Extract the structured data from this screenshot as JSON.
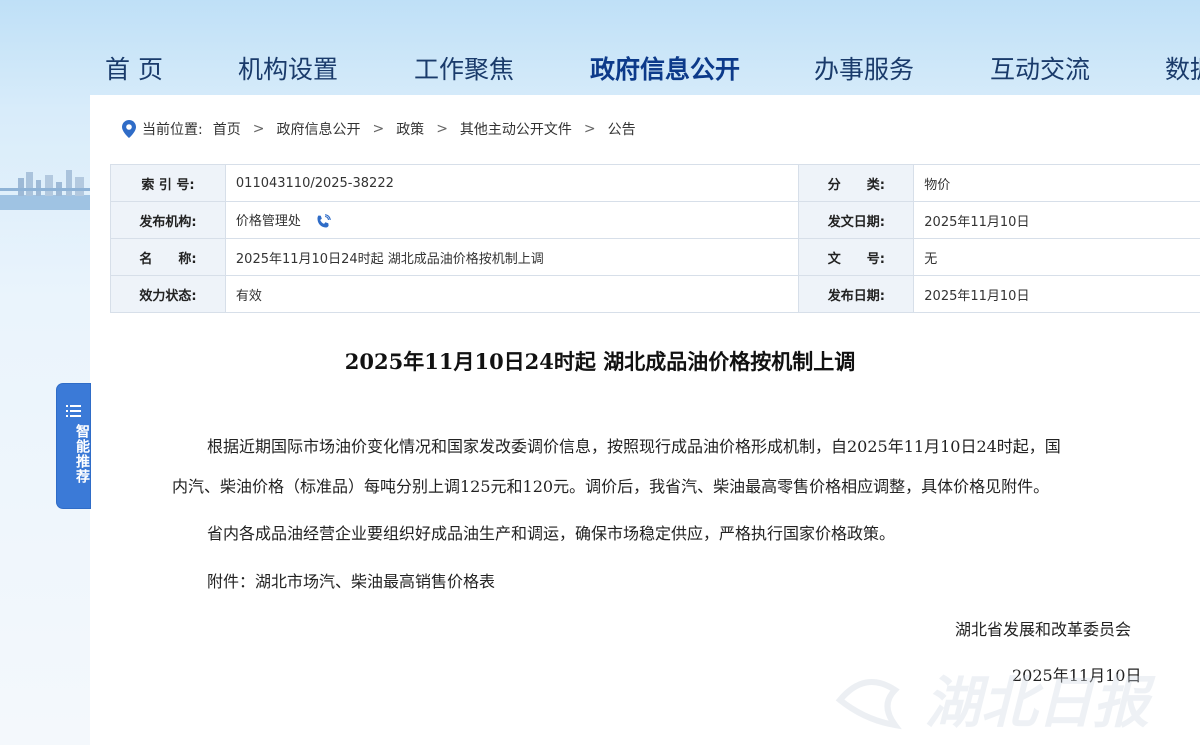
{
  "nav": {
    "items": [
      "首 页",
      "机构设置",
      "工作聚焦",
      "政府信息公开",
      "办事服务",
      "互动交流",
      "数据"
    ],
    "active_index": 3
  },
  "breadcrumb": {
    "prefix": "当前位置:",
    "items": [
      "首页",
      "政府信息公开",
      "政策",
      "其他主动公开文件",
      "公告"
    ],
    "separator": ">"
  },
  "meta": {
    "index_label": "索 引 号:",
    "index_value": "011043110/2025-38222",
    "category_label": "分　　类:",
    "category_value": "物价",
    "issuer_label": "发布机构:",
    "issuer_value": "价格管理处",
    "issue_date_label": "发文日期:",
    "issue_date_value": "2025年11月10日",
    "name_label": "名　　称:",
    "name_value": "2025年11月10日24时起 湖北成品油价格按机制上调",
    "doc_no_label": "文　　号:",
    "doc_no_value": "无",
    "status_label": "效力状态:",
    "status_value": "有效",
    "publish_date_label": "发布日期:",
    "publish_date_value": "2025年11月10日"
  },
  "article": {
    "title": "2025年11月10日24时起  湖北成品油价格按机制上调",
    "p1_line1": "根据近期国际市场油价变化情况和国家发改委调价信息，按照现行成品油价格形成机制，自2025年11月10日24时起，国",
    "p1_line2": "内汽、柴油价格（标准品）每吨分别上调125元和120元。调价后，我省汽、柴油最高零售价格相应调整，具体价格见附件。",
    "p2": "省内各成品油经营企业要组织好成品油生产和调运，确保市场稳定供应，严格执行国家价格政策。",
    "attachment": "附件：湖北市场汽、柴油最高销售价格表",
    "signature": "湖北省发展和改革委员会",
    "date": "2025年11月10日"
  },
  "side_tab": {
    "label": "智能推荐",
    "icon": "menu-lines-icon"
  },
  "watermark": {
    "text": "湖北日报"
  },
  "colors": {
    "nav_text": "#1a3b6b",
    "side_tab": "#3b7ad7",
    "table_label_bg": "#eef3f9",
    "table_border": "#d7dfe9"
  }
}
